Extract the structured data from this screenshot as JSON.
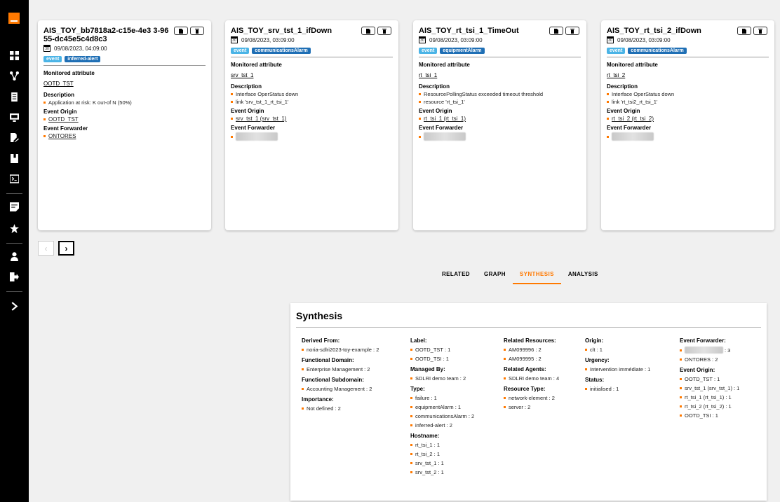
{
  "cards": [
    {
      "title": "AIS_TOY_bb7818a2-c15e-4e3 3-9655-dc45e5c4d8c3",
      "date": "09/08/2023, 04:09:00",
      "tag_event": "event",
      "tag_kind": "inferred-alert",
      "monitored_label": "Monitored attribute",
      "monitored": "OOTD_TST",
      "description_label": "Description",
      "description": [
        "Application at risk: K out-of N (50%)"
      ],
      "origin_label": "Event Origin",
      "origin": "OOTD_TST",
      "forwarder_label": "Event Forwarder",
      "forwarder": "ONTORES"
    },
    {
      "title": "AIS_TOY_srv_tst_1_ifDown",
      "date": "09/08/2023, 03:09:00",
      "tag_event": "event",
      "tag_kind": "communicationsAlarm",
      "monitored_label": "Monitored attribute",
      "monitored": "srv_tst_1",
      "description_label": "Description",
      "description": [
        "Interface OperStatus down",
        "link 'srv_tst_1_rt_tsi_1'"
      ],
      "origin_label": "Event Origin",
      "origin": "srv_tst_1 (srv_tst_1)",
      "forwarder_label": "Event Forwarder",
      "forwarder": ""
    },
    {
      "title": "AIS_TOY_rt_tsi_1_TimeOut",
      "date": "09/08/2023, 03:09:00",
      "tag_event": "event",
      "tag_kind": "equipmentAlarm",
      "monitored_label": "Monitored attribute",
      "monitored": "rt_tsi_1",
      "description_label": "Description",
      "description": [
        "ResourcePollingStatus exceeded timeout threshold",
        "resource 'rt_tsi_1'"
      ],
      "origin_label": "Event Origin",
      "origin": "rt_tsi_1 (rt_tsi_1)",
      "forwarder_label": "Event Forwarder",
      "forwarder": ""
    },
    {
      "title": "AIS_TOY_rt_tsi_2_ifDown",
      "date": "09/08/2023, 03:09:00",
      "tag_event": "event",
      "tag_kind": "communicationsAlarm",
      "monitored_label": "Monitored attribute",
      "monitored": "rt_tsi_2",
      "description_label": "Description",
      "description": [
        "Interface OperStatus down",
        "link 'rt_tsi2_rt_tsi_1'"
      ],
      "origin_label": "Event Origin",
      "origin": "rt_tsi_2 (rt_tsi_2)",
      "forwarder_label": "Event Forwarder",
      "forwarder": ""
    }
  ],
  "calendar_day": "30",
  "tabs": [
    "RELATED",
    "GRAPH",
    "SYNTHESIS",
    "ANALYSIS"
  ],
  "active_tab": "SYNTHESIS",
  "synthesis": {
    "title": "Synthesis",
    "col1": [
      {
        "label": "Derived From:",
        "items": [
          "noria-sdlri2023-toy-example : 2"
        ]
      },
      {
        "label": "Functional Domain:",
        "items": [
          "Enterprise Management : 2"
        ]
      },
      {
        "label": "Functional Subdomain:",
        "items": [
          "Accounting Management : 2"
        ]
      },
      {
        "label": "Importance:",
        "items": [
          "Not defined : 2"
        ]
      }
    ],
    "col2": [
      {
        "label": "Label:",
        "items": [
          "OOTD_TST : 1",
          "OOTD_TSI : 1"
        ]
      },
      {
        "label": "Managed By:",
        "items": [
          "SDLRI demo team : 2"
        ]
      },
      {
        "label": "Type:",
        "items": [
          "failure : 1",
          "equipmentAlarm : 1",
          "communicationsAlarm : 2",
          "inferred-alert : 2"
        ]
      },
      {
        "label": "Hostname:",
        "items": [
          "rt_tsi_1 : 1",
          "rt_tsi_2 : 1",
          "srv_tst_1 : 1",
          "srv_tst_2 : 1"
        ]
      }
    ],
    "col3": [
      {
        "label": "Related Resources:",
        "items": [
          "AM099996 : 2",
          "AM099995 : 2"
        ]
      },
      {
        "label": "Related Agents:",
        "items": [
          "SDLRI demo team : 4"
        ]
      },
      {
        "label": "Resource Type:",
        "items": [
          "network-element : 2",
          "server : 2"
        ]
      }
    ],
    "col4": [
      {
        "label": "Origin:",
        "items": [
          "clt : 1"
        ]
      },
      {
        "label": "Urgency:",
        "items": [
          "Intervention immédiate : 1"
        ]
      },
      {
        "label": "Status:",
        "items": [
          "initialised : 1"
        ]
      }
    ],
    "col5": [
      {
        "label": "Event Forwarder:",
        "items": [
          ": 3",
          "ONTORES : 2"
        ]
      },
      {
        "label": "Event Origin:",
        "items": [
          "OOTD_TST : 1",
          "srv_tst_1 (srv_tst_1) : 1",
          "rt_tsi_1 (rt_tsi_1) : 1",
          "rt_tsi_2 (rt_tsi_2) : 1",
          "OOTD_TSI : 1"
        ]
      }
    ]
  },
  "colors": {
    "accent": "#ff7900",
    "tag_event": "#4bb4e6",
    "tag_kind": "#1f6fb5"
  }
}
